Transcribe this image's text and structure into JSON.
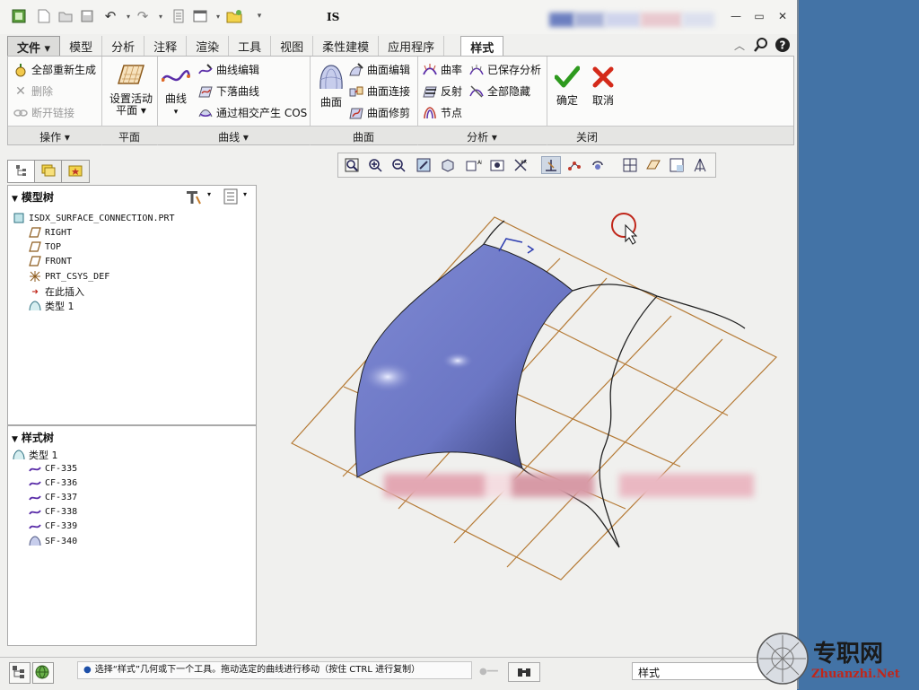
{
  "window": {
    "title": "IS",
    "minimize": "—",
    "restore": "▭",
    "close": "✕",
    "quick_access": [
      "new-icon",
      "open-icon",
      "save-icon",
      "undo-icon",
      "redo-icon",
      "regenerate-icon",
      "windows-icon",
      "folder-icon",
      "customize-icon"
    ]
  },
  "tabs": {
    "file": "文件 ▾",
    "items": [
      "模型",
      "分析",
      "注释",
      "渲染",
      "工具",
      "视图",
      "柔性建模",
      "应用程序"
    ],
    "active": "样式"
  },
  "ribbon": {
    "operations": {
      "regenerate_all": "全部重新生成",
      "delete": "删除",
      "break_link": "断开链接",
      "label": "操作 ▾"
    },
    "plane": {
      "set_active_plane_line1": "设置活动",
      "set_active_plane_line2": "平面 ▾",
      "label": "平面"
    },
    "curves": {
      "curve_line1": "曲线",
      "curve_line2": "▾",
      "curve_edit": "曲线编辑",
      "drop_curve": "下落曲线",
      "cos": "通过相交产生 COS",
      "label": "曲线 ▾"
    },
    "surfaces": {
      "surface": "曲面",
      "surface_edit": "曲面编辑",
      "surface_connect": "曲面连接",
      "surface_trim": "曲面修剪",
      "label": "曲面"
    },
    "analysis": {
      "curvature": "曲率",
      "saved_analysis": "已保存分析",
      "reflection": "反射",
      "hide_all": "全部隐藏",
      "node": "节点",
      "label": "分析 ▾"
    },
    "close": {
      "ok": "确定",
      "cancel": "取消",
      "label": "关闭"
    }
  },
  "model_tree": {
    "title": "模型树",
    "items": [
      {
        "label": "ISDX_SURFACE_CONNECTION.PRT",
        "icon": "part-icon"
      },
      {
        "label": "RIGHT",
        "icon": "datum-plane-icon"
      },
      {
        "label": "TOP",
        "icon": "datum-plane-icon"
      },
      {
        "label": "FRONT",
        "icon": "datum-plane-icon"
      },
      {
        "label": "PRT_CSYS_DEF",
        "icon": "csys-icon"
      },
      {
        "label": "在此插入",
        "icon": "insert-here-arrow-icon"
      },
      {
        "label": "类型 1",
        "icon": "style-feature-icon"
      }
    ]
  },
  "style_tree": {
    "title": "样式树",
    "items": [
      {
        "label": "类型 1",
        "icon": "style-feature-icon"
      },
      {
        "label": "CF-335",
        "icon": "curve-icon"
      },
      {
        "label": "CF-336",
        "icon": "curve-icon"
      },
      {
        "label": "CF-337",
        "icon": "curve-icon"
      },
      {
        "label": "CF-338",
        "icon": "curve-icon"
      },
      {
        "label": "CF-339",
        "icon": "curve-icon"
      },
      {
        "label": "SF-340",
        "icon": "surface-icon"
      }
    ]
  },
  "status": {
    "message": "选择“样式”几何或下一个工具。拖动选定的曲线进行移动（按住 CTRL 进行复制）",
    "filter": "样式"
  },
  "watermark": {
    "cn": "专职网",
    "en": "Zhuanzhi.Net"
  },
  "colors": {
    "surface": "#6d78c6",
    "grid": "#b57a35",
    "accent_check": "#2e9a1e",
    "accent_cancel": "#d42a1a",
    "desktop": "#4373a6"
  }
}
